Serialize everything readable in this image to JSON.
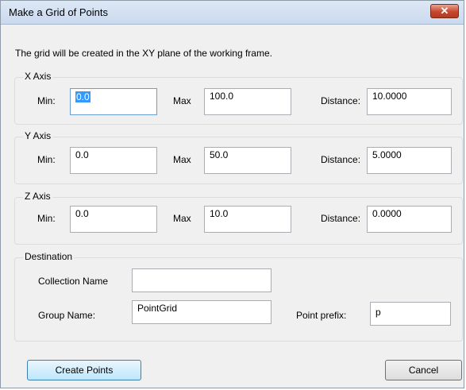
{
  "window": {
    "title": "Make a Grid of Points",
    "close_glyph": "✕"
  },
  "intro": "The grid will be created in the XY plane of the working frame.",
  "x_axis": {
    "legend": "X Axis",
    "min_label": "Min:",
    "min_value": "0.0",
    "max_label": "Max",
    "max_value": "100.0",
    "distance_label": "Distance:",
    "distance_value": "10.0000"
  },
  "y_axis": {
    "legend": "Y Axis",
    "min_label": "Min:",
    "min_value": "0.0",
    "max_label": "Max",
    "max_value": "50.0",
    "distance_label": "Distance:",
    "distance_value": "5.0000"
  },
  "z_axis": {
    "legend": "Z Axis",
    "min_label": "Min:",
    "min_value": "0.0",
    "max_label": "Max",
    "max_value": "10.0",
    "distance_label": "Distance:",
    "distance_value": "0.0000"
  },
  "destination": {
    "legend": "Destination",
    "collection_label": "Collection Name",
    "collection_value": "",
    "group_label": "Group Name:",
    "group_value": "PointGrid",
    "prefix_label": "Point prefix:",
    "prefix_value": "p"
  },
  "buttons": {
    "create": "Create Points",
    "cancel": "Cancel"
  },
  "colors": {
    "primary_button_border": "#3c7fb1",
    "close_button": "#c7472c",
    "selection": "#3399ff"
  }
}
